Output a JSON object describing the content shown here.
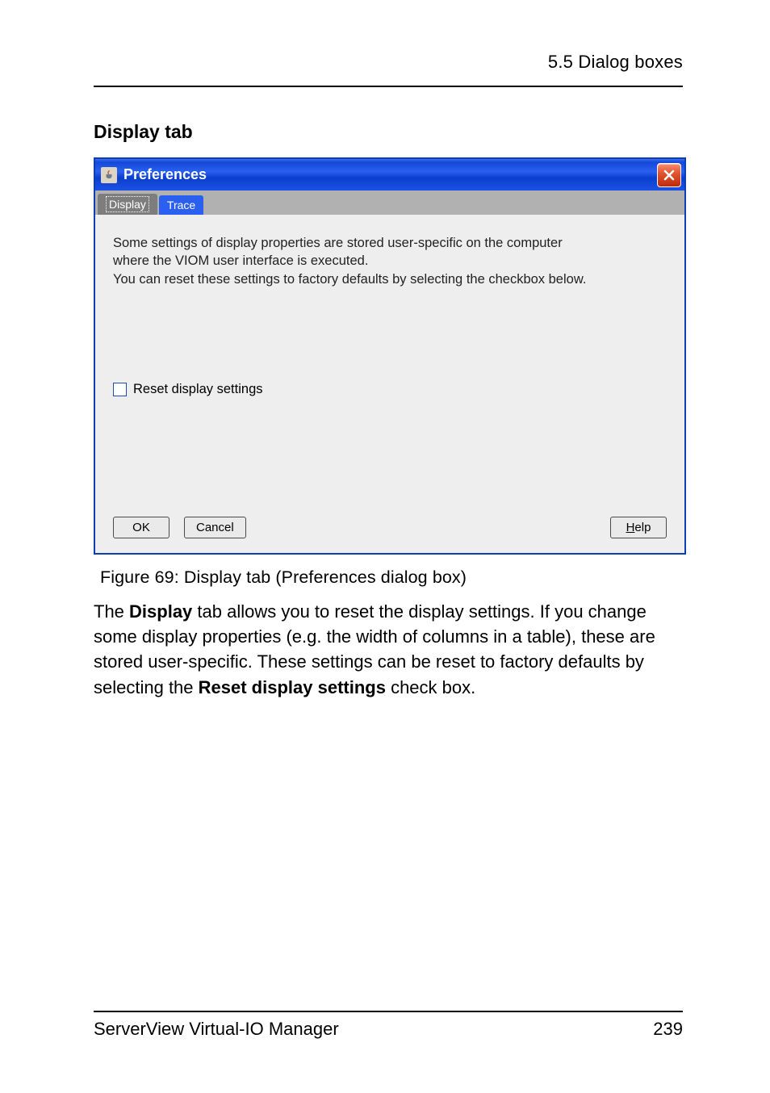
{
  "header": {
    "right_text": "5.5 Dialog boxes"
  },
  "section": {
    "title": "Display tab"
  },
  "dialog": {
    "title": "Preferences",
    "tabs": {
      "display": "Display",
      "trace": "Trace"
    },
    "description_line1": "Some settings of display properties are stored user-specific on the computer",
    "description_line2": "where the VIOM user interface is executed.",
    "description_line3": "You can reset these settings to factory defaults by selecting the checkbox below.",
    "checkbox_label": "Reset display settings",
    "buttons": {
      "ok": "OK",
      "cancel": "Cancel",
      "help_prefix": "H",
      "help_rest": "elp"
    }
  },
  "caption": "Figure 69: Display tab (Preferences dialog box)",
  "paragraph": {
    "pre1": "The ",
    "b1": "Display",
    "post1": " tab allows you to reset the display settings. If you change some display properties (e.g. the width of columns in a table), these are stored user-specific. These settings can be reset to factory defaults by selecting the ",
    "b2": "Reset display settings",
    "post2": " check box."
  },
  "footer": {
    "left": "ServerView Virtual-IO Manager",
    "right": "239"
  }
}
